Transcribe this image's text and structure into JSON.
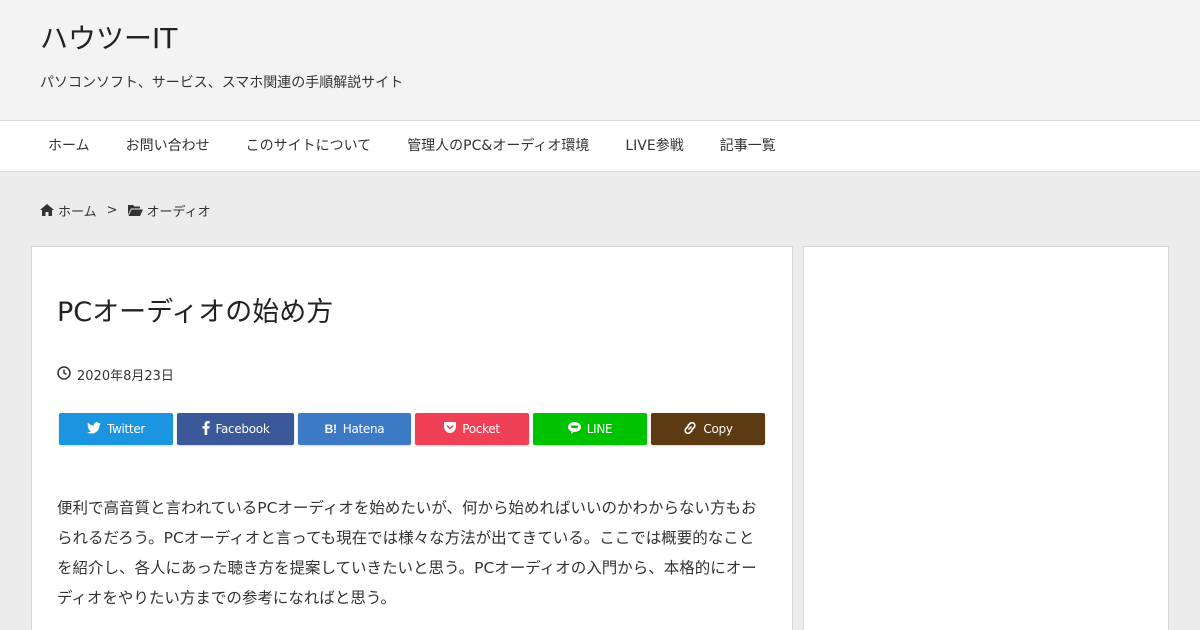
{
  "header": {
    "site_title": "ハウツーIT",
    "tagline": "パソコンソフト、サービス、スマホ関連の手順解説サイト"
  },
  "nav": {
    "items": [
      "ホーム",
      "お問い合わせ",
      "このサイトについて",
      "管理人のPC&オーディオ環境",
      "LIVE参戦",
      "記事一覧"
    ]
  },
  "breadcrumb": {
    "home": "ホーム",
    "separator": ">",
    "category": "オーディオ"
  },
  "article": {
    "title": "PCオーディオの始め方",
    "date": "2020年8月23日",
    "body": "便利で高音質と言われているPCオーディオを始めたいが、何から始めればいいのかわからない方もおられるだろう。PCオーディオと言っても現在では様々な方法が出てきている。ここでは概要的なことを紹介し、各人にあった聴き方を提案していきたいと思う。PCオーディオの入門から、本格的にオーディオをやりたい方までの参考になればと思う。"
  },
  "share": {
    "buttons": [
      {
        "label": "Twitter",
        "icon": "twitter-icon",
        "color": "#1b95e0"
      },
      {
        "label": "Facebook",
        "icon": "facebook-icon",
        "color": "#3b5998"
      },
      {
        "label": "Hatena",
        "icon": "hatena-icon",
        "color": "#3c7ac6"
      },
      {
        "label": "Pocket",
        "icon": "pocket-icon",
        "color": "#ef4056"
      },
      {
        "label": "LINE",
        "icon": "line-icon",
        "color": "#00c300"
      },
      {
        "label": "Copy",
        "icon": "link-icon",
        "color": "#5c3a12"
      }
    ]
  },
  "colors": {
    "page_bg": "#ececec",
    "header_bg": "#f3f3f3",
    "card_bg": "#ffffff"
  }
}
